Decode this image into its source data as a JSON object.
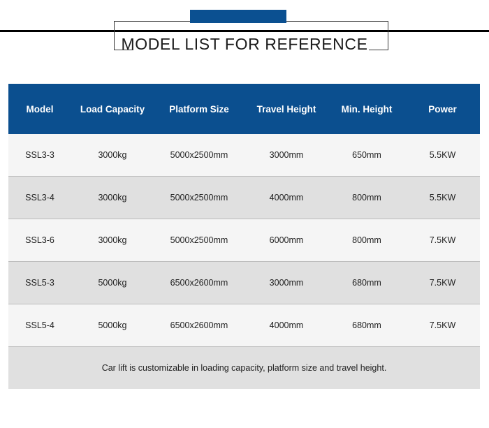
{
  "banner": {
    "title": "MODEL LIST FOR REFERENCE",
    "accent_color": "#0b5091",
    "rule_color": "#000000",
    "frame_color": "#3a3a3a"
  },
  "table": {
    "header_bg": "#0b4f8f",
    "header_text_color": "#ffffff",
    "row_odd_bg": "#f5f5f5",
    "row_even_bg": "#e0e0e0",
    "border_color": "#bdbdbd",
    "columns": [
      "Model",
      "Load Capacity",
      "Platform Size",
      "Travel Height",
      "Min. Height",
      "Power"
    ],
    "rows": [
      [
        "SSL3-3",
        "3000kg",
        "5000x2500mm",
        "3000mm",
        "650mm",
        "5.5KW"
      ],
      [
        "SSL3-4",
        "3000kg",
        "5000x2500mm",
        "4000mm",
        "800mm",
        "5.5KW"
      ],
      [
        "SSL3-6",
        "3000kg",
        "5000x2500mm",
        "6000mm",
        "800mm",
        "7.5KW"
      ],
      [
        "SSL5-3",
        "5000kg",
        "6500x2600mm",
        "3000mm",
        "680mm",
        "7.5KW"
      ],
      [
        "SSL5-4",
        "5000kg",
        "6500x2600mm",
        "4000mm",
        "680mm",
        "7.5KW"
      ]
    ],
    "note": "Car lift is customizable in loading capacity, platform size and travel height."
  },
  "chart_data": {
    "type": "table",
    "title": "MODEL LIST FOR REFERENCE",
    "columns": [
      "Model",
      "Load Capacity",
      "Platform Size",
      "Travel Height",
      "Min. Height",
      "Power"
    ],
    "rows": [
      {
        "Model": "SSL3-3",
        "Load Capacity": "3000kg",
        "Platform Size": "5000x2500mm",
        "Travel Height": "3000mm",
        "Min. Height": "650mm",
        "Power": "5.5KW"
      },
      {
        "Model": "SSL3-4",
        "Load Capacity": "3000kg",
        "Platform Size": "5000x2500mm",
        "Travel Height": "4000mm",
        "Min. Height": "800mm",
        "Power": "5.5KW"
      },
      {
        "Model": "SSL3-6",
        "Load Capacity": "3000kg",
        "Platform Size": "5000x2500mm",
        "Travel Height": "6000mm",
        "Min. Height": "800mm",
        "Power": "7.5KW"
      },
      {
        "Model": "SSL5-3",
        "Load Capacity": "5000kg",
        "Platform Size": "6500x2600mm",
        "Travel Height": "3000mm",
        "Min. Height": "680mm",
        "Power": "7.5KW"
      },
      {
        "Model": "SSL5-4",
        "Load Capacity": "5000kg",
        "Platform Size": "6500x2600mm",
        "Travel Height": "4000mm",
        "Min. Height": "680mm",
        "Power": "7.5KW"
      }
    ],
    "footnote": "Car lift is customizable in loading capacity, platform size and travel height."
  }
}
